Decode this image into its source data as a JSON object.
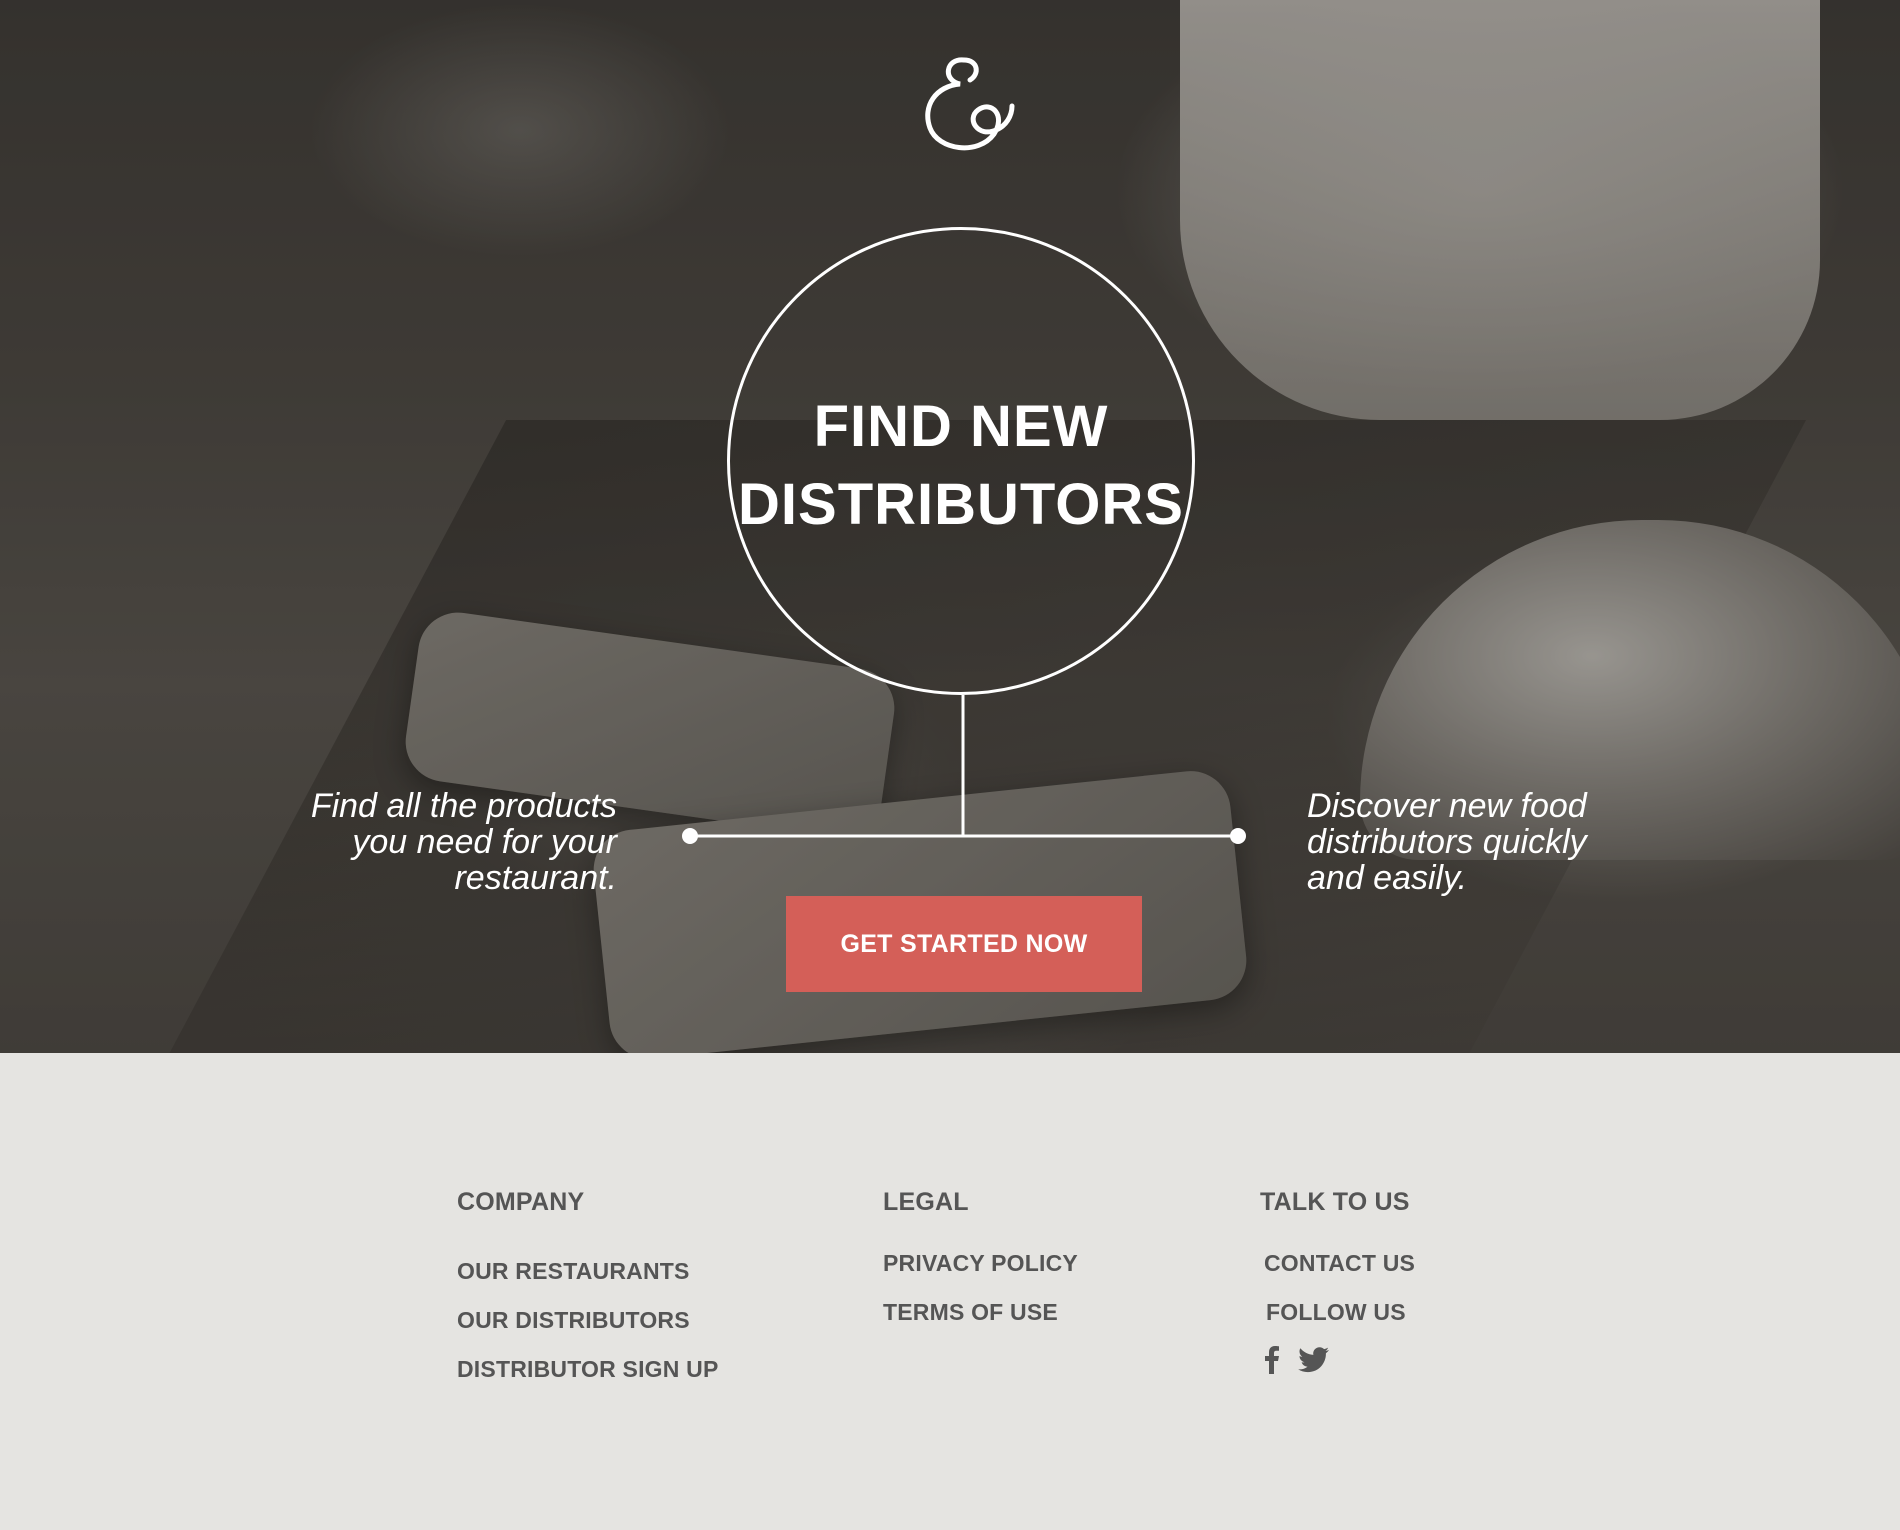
{
  "hero": {
    "title_line1": "FIND NEW",
    "title_line2": "DISTRIBUTORS",
    "left_text": [
      "Find all the products",
      "you need for your",
      "restaurant."
    ],
    "right_text": [
      "Discover new food",
      "distributors quickly",
      "and easily."
    ],
    "cta_label": "GET STARTED NOW",
    "logo_icon": "ampersand-logo-icon"
  },
  "footer": {
    "company": {
      "heading": "COMPANY",
      "links": [
        "OUR RESTAURANTS",
        "OUR DISTRIBUTORS",
        "DISTRIBUTOR SIGN UP"
      ]
    },
    "legal": {
      "heading": "LEGAL",
      "links": [
        "PRIVACY POLICY",
        "TERMS OF USE"
      ]
    },
    "talk": {
      "heading": "TALK TO US",
      "links": [
        "CONTACT US",
        "FOLLOW US"
      ],
      "social_icons": [
        "facebook-icon",
        "twitter-icon"
      ]
    }
  },
  "colors": {
    "accent": "#d45f58",
    "footer_bg": "#e5e4e1",
    "footer_text": "#555555",
    "hero_text": "#ffffff"
  }
}
